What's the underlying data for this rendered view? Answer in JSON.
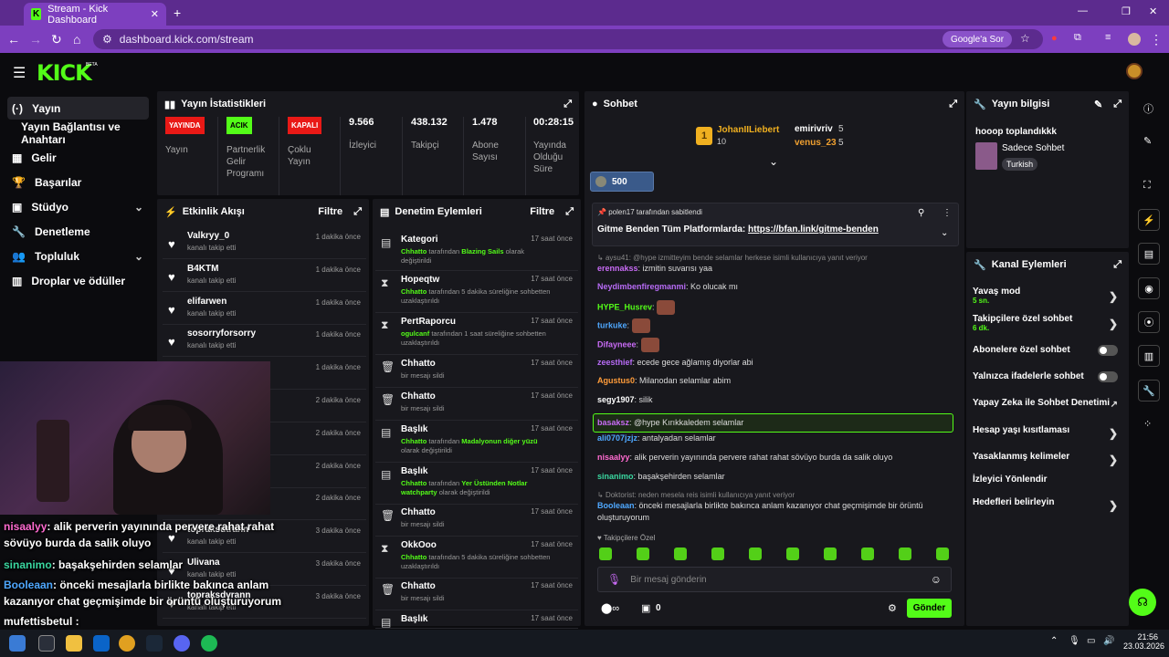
{
  "browser": {
    "tab_title": "Stream - Kick Dashboard",
    "url": "dashboard.kick.com/stream",
    "google_search": "Google'a Sor"
  },
  "app": {
    "logo": "KICK",
    "beta": "BETA"
  },
  "sidebar": {
    "items": [
      {
        "label": "Yayın",
        "icon": "stream-icon"
      },
      {
        "label": "Yayın Bağlantısı ve Anahtarı",
        "icon": ""
      },
      {
        "label": "Gelir",
        "icon": "revenue-icon"
      },
      {
        "label": "Başarılar",
        "icon": "trophy-icon"
      },
      {
        "label": "Stüdyo",
        "icon": "studio-icon"
      },
      {
        "label": "Denetleme",
        "icon": "wrench-icon"
      },
      {
        "label": "Topluluk",
        "icon": "community-icon"
      },
      {
        "label": "Droplar ve ödüller",
        "icon": "gift-icon"
      }
    ]
  },
  "stats": {
    "title": "Yayın İstatistikleri",
    "live_badge": "YAYINDA",
    "live_label": "Yayın",
    "partner_badge": "ACIK",
    "partner_label": "Partnerlik Gelir Programı",
    "multi_badge": "KAPALI",
    "multi_label": "Çoklu Yayın",
    "viewers": "9.566",
    "viewers_label": "İzleyici",
    "followers": "438.132",
    "followers_label": "Takipçi",
    "subs": "1.478",
    "subs_label": "Abone Sayısı",
    "uptime": "00:28:15",
    "uptime_label": "Yayında Olduğu Süre"
  },
  "activity": {
    "title": "Etkinlik Akışı",
    "filter": "Filtre",
    "items": [
      {
        "name": "Valkryy_0",
        "sub": "kanalı takip etti",
        "time": "1 dakika önce"
      },
      {
        "name": "B4KTM",
        "sub": "kanalı takip etti",
        "time": "1 dakika önce"
      },
      {
        "name": "elifarwen",
        "sub": "kanalı takip etti",
        "time": "1 dakika önce"
      },
      {
        "name": "sosorryforsorry",
        "sub": "kanalı takip etti",
        "time": "1 dakika önce"
      },
      {
        "name": "",
        "sub": "",
        "time": "1 dakika önce"
      },
      {
        "name": "",
        "sub": "",
        "time": "2 dakika önce"
      },
      {
        "name": "",
        "sub": "",
        "time": "2 dakika önce"
      },
      {
        "name": "",
        "sub": "",
        "time": "2 dakika önce"
      },
      {
        "name": "",
        "sub": "",
        "time": "2 dakika önce"
      },
      {
        "name": "topraksutrahn",
        "sub": "kanalı takip etti",
        "time": "3 dakika önce"
      },
      {
        "name": "Ulivana",
        "sub": "kanalı takip etti",
        "time": "3 dakika önce"
      },
      {
        "name": "topraksdvrann",
        "sub": "kanalı takip etti",
        "time": "3 dakika önce"
      }
    ]
  },
  "moderation": {
    "title": "Denetim Eylemleri",
    "filter": "Filtre",
    "items": [
      {
        "title": "Kategori",
        "time": "17 saat önce",
        "actor": "Chhatto",
        "mid": " tarafından ",
        "target": "Blazing Sails",
        "rest": " olarak değiştirildi"
      },
      {
        "title": "Hopeqtw",
        "time": "17 saat önce",
        "actor": "Chhatto",
        "mid": " tarafından 5 dakika süreliğine sohbetten uzaklaştırıldı",
        "target": "",
        "rest": ""
      },
      {
        "title": "PertRaporcu",
        "time": "17 saat önce",
        "actor": "ogulcanf",
        "mid": " tarafından 1 saat süreliğine sohbetten uzaklaştırıldı",
        "target": "",
        "rest": ""
      },
      {
        "title": "Chhatto",
        "time": "17 saat önce",
        "actor": "",
        "mid": "bir mesajı sildi",
        "target": "",
        "rest": ""
      },
      {
        "title": "Chhatto",
        "time": "17 saat önce",
        "actor": "",
        "mid": "bir mesajı sildi",
        "target": "",
        "rest": ""
      },
      {
        "title": "Başlık",
        "time": "17 saat önce",
        "actor": "Chhatto",
        "mid": " tarafından ",
        "target": "Madalyonun diğer yüzü",
        "rest": " olarak değiştirildi"
      },
      {
        "title": "Başlık",
        "time": "17 saat önce",
        "actor": "Chhatto",
        "mid": " tarafından ",
        "target": "Yer Üstünden Notlar watchparty",
        "rest": " olarak değiştirildi"
      },
      {
        "title": "Chhatto",
        "time": "17 saat önce",
        "actor": "",
        "mid": "bir mesajı sildi",
        "target": "",
        "rest": ""
      },
      {
        "title": "OkkOoo",
        "time": "17 saat önce",
        "actor": "Chhatto",
        "mid": " tarafından 5 dakika süreliğine sohbetten uzaklaştırıldı",
        "target": "",
        "rest": ""
      },
      {
        "title": "Chhatto",
        "time": "17 saat önce",
        "actor": "",
        "mid": "bir mesajı sildi",
        "target": "",
        "rest": ""
      },
      {
        "title": "Başlık",
        "time": "17 saat önce",
        "actor": "",
        "mid": "",
        "target": "",
        "rest": ""
      }
    ]
  },
  "chat": {
    "title": "Sohbet",
    "leader1": {
      "name": "JohanIILiebert",
      "count": "10"
    },
    "leader2": {
      "name": "emirivriv",
      "count": "5"
    },
    "leader3": {
      "name": "venus_23",
      "count": "5"
    },
    "gift_count": "500",
    "pinned_by": "polen17 tarafından sabitlendi",
    "pinned_text": "Gitme Benden Tüm Platformlarda: ",
    "pinned_link": "https://bfan.link/gitme-benden",
    "messages": [
      {
        "reply": "aysu41: @hype izmitteyim bende selamlar herkese isimli kullanıcıya yanıt veriyor"
      },
      {
        "user": "erennakss",
        "color": "#c86bf5",
        "text": ": izmitin suvarısı yaa"
      },
      {
        "user": "Neydimbenfiregmanmi",
        "color": "#b76bf5",
        "text": ": Ko olucak mı"
      },
      {
        "user": "HYPE_Husrev",
        "color": "#53fc18",
        "text": ":"
      },
      {
        "user": "turkuke",
        "color": "#4fa8ff",
        "text": ":"
      },
      {
        "user": "Difayneee",
        "color": "#c86bf5",
        "text": ":"
      },
      {
        "user": "zeesthief",
        "color": "#b76bf5",
        "text": ": ecede gece ağlamış diyorlar abi"
      },
      {
        "user": "Agustus0",
        "color": "#ff9c3a",
        "text": ": Milanodan selamlar abim"
      },
      {
        "user": "segy1907",
        "color": "#ffffff",
        "text": ": silik"
      },
      {
        "user": "basaksz",
        "color": "#c86bf5",
        "text": ": @hype Kırıkkaledem selamlar"
      },
      {
        "user": "ali0707jzjz",
        "color": "#4fa8ff",
        "text": ": antalyadan selamlar"
      },
      {
        "user": "nisaalyy",
        "color": "#ff6bd0",
        "text": ": alik perverin yayınında pervere rahat rahat sövüyo burda da salik oluyo"
      },
      {
        "user": "sinanimo",
        "color": "#3ad8a0",
        "text": ": başakşehirden selamlar"
      },
      {
        "reply": "Doktorist: neden mesela reis isimli kullanıcıya yanıt veriyor"
      },
      {
        "user": "Booleaan",
        "color": "#4fa8ff",
        "text": ": önceki mesajlarla birlikte bakınca anlam kazanıyor chat geçmişimde bir örüntü oluşturuyorum"
      }
    ],
    "followers_only": "Takipçilere Özel",
    "placeholder": "Bir mesaj gönderin",
    "points": "0",
    "send": "Gönder"
  },
  "stream_info": {
    "title": "Yayın bilgisi",
    "stream_title": "hooop toplandıkkk",
    "category": "Sadece Sohbet",
    "language": "Turkish"
  },
  "channel_actions": {
    "title": "Kanal Eylemleri",
    "slow_mode": "Yavaş mod",
    "slow_mode_value": "5 sn.",
    "followers_chat": "Takipçilere özel sohbet",
    "followers_chat_value": "6 dk.",
    "subs_chat": "Abonelere özel sohbet",
    "emote_chat": "Yalnızca ifadelerle sohbet",
    "ai_mod": "Yapay Zeka ile Sohbet Denetimi",
    "account_age": "Hesap yaşı kısıtlaması",
    "banned_words": "Yasaklanmış kelimeler",
    "redirect": "İzleyici Yönlendir",
    "goals": "Hedefleri belirleyin"
  },
  "overlay_chat": [
    {
      "user": "nisaalyy",
      "color": "#ff6bd0",
      "text": ": alik perverin yayınında pervere rahat rahat"
    },
    {
      "user": "",
      "color": "#fff",
      "text": "sövüyo burda da salik oluyo"
    },
    {
      "user": "sinanimo",
      "color": "#3ad8a0",
      "text": ": başakşehirden selamlar"
    },
    {
      "user": "Booleaan",
      "color": "#4fa8ff",
      "text": ": önceki mesajlarla birlikte bakınca anlam"
    },
    {
      "user": "",
      "color": "#fff",
      "text": "kazanıyor chat geçmişimde bir örüntü oluşturuyorum"
    },
    {
      "user": "mufettisbetul",
      "color": "#fff",
      "text": " :"
    }
  ],
  "taskbar": {
    "time": "21:56",
    "date": "23.03.2026"
  },
  "colors": {
    "accent": "#53fc18",
    "live": "#e91916",
    "browser": "#7d3fbf"
  }
}
